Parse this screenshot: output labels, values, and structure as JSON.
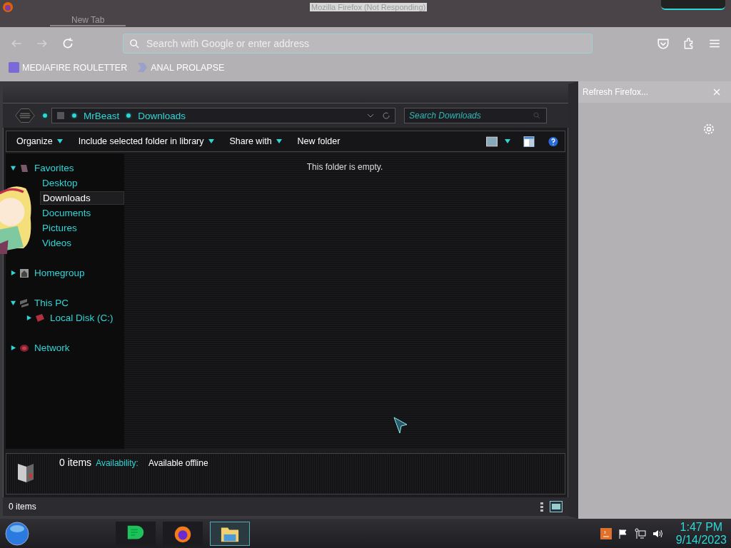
{
  "browser": {
    "title": "Mozilla Firefox (Not Responding)",
    "tabs": [
      {
        "label": "New Tab",
        "selected": true
      }
    ],
    "address": {
      "placeholder": "Search with Google or enter address"
    },
    "bookmarks": [
      {
        "label": "MEDIAFIRE ROULETTER",
        "kind": "mf"
      },
      {
        "label": "ANAL PROLAPSE",
        "kind": "chevron"
      }
    ],
    "notification": {
      "text": "Refresh Firefox..."
    }
  },
  "explorer": {
    "breadcrumb": [
      "MrBeast",
      "Downloads"
    ],
    "search": {
      "placeholder": "Search Downloads"
    },
    "commands": [
      {
        "label": "Organize",
        "dropdown": true
      },
      {
        "label": "Include selected folder in library",
        "dropdown": true
      },
      {
        "label": "Share with",
        "dropdown": true
      },
      {
        "label": "New folder",
        "dropdown": false
      }
    ],
    "tree": [
      {
        "label": "Favorites",
        "kind": "star",
        "expanded": true,
        "selected": false,
        "children": [
          {
            "label": "Desktop",
            "kind": "leaf",
            "selected": false
          },
          {
            "label": "Downloads",
            "kind": "leaf",
            "selected": true
          },
          {
            "label": "Documents",
            "kind": "leaf",
            "selected": false
          },
          {
            "label": "Pictures",
            "kind": "leaf",
            "selected": false
          },
          {
            "label": "Videos",
            "kind": "leaf",
            "selected": false
          }
        ]
      },
      {
        "label": "Homegroup",
        "kind": "home",
        "expanded": false,
        "selected": false
      },
      {
        "label": "This PC",
        "kind": "pc",
        "expanded": true,
        "selected": false,
        "children": [
          {
            "label": "Local Disk (C:)",
            "kind": "disk",
            "expanded": false,
            "selected": false
          }
        ]
      },
      {
        "label": "Network",
        "kind": "network",
        "expanded": false,
        "selected": false
      }
    ],
    "empty_message": "This folder is empty.",
    "details": {
      "count": "0 items",
      "label": "Availability:",
      "value": "Available offline"
    },
    "status": "0 items"
  },
  "taskbar": {
    "apps": [
      {
        "kind": "chat",
        "selected": false
      },
      {
        "kind": "firefox",
        "selected": false
      },
      {
        "kind": "explorer",
        "selected": true
      }
    ],
    "clock": {
      "time": "1:47 PM",
      "date": "9/14/2023"
    }
  }
}
